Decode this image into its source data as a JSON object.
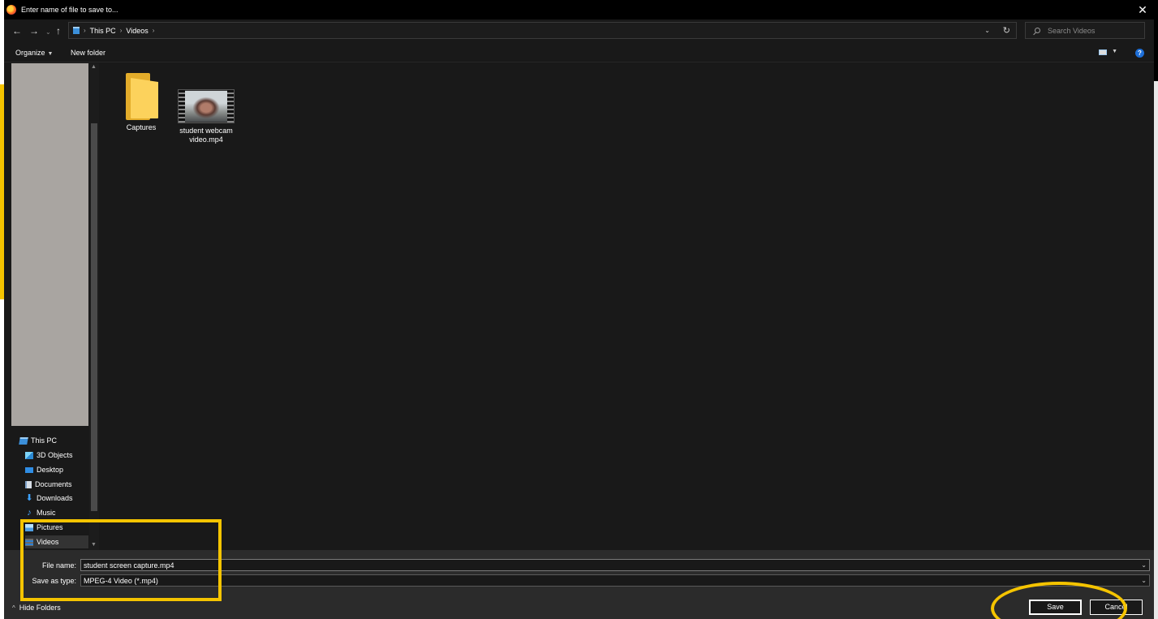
{
  "window": {
    "title": "Enter name of file to save to..."
  },
  "navigation": {
    "breadcrumb": [
      "This PC",
      "Videos"
    ],
    "search_placeholder": "Search Videos"
  },
  "toolbar": {
    "organize_label": "Organize",
    "new_folder_label": "New folder",
    "help_glyph": "?"
  },
  "sidebar": {
    "items": [
      {
        "label": "This PC",
        "icon": "this-pc-icon"
      },
      {
        "label": "3D Objects",
        "icon": "3d-objects-icon"
      },
      {
        "label": "Desktop",
        "icon": "desktop-icon"
      },
      {
        "label": "Documents",
        "icon": "documents-icon"
      },
      {
        "label": "Downloads",
        "icon": "downloads-icon"
      },
      {
        "label": "Music",
        "icon": "music-icon"
      },
      {
        "label": "Pictures",
        "icon": "pictures-icon"
      },
      {
        "label": "Videos",
        "icon": "videos-icon",
        "selected": true
      }
    ]
  },
  "files": [
    {
      "name": "Captures",
      "type": "folder"
    },
    {
      "name_line1": "student webcam",
      "name_line2": "video.mp4",
      "type": "video"
    }
  ],
  "form": {
    "file_name_label": "File name:",
    "file_name_value": "student screen capture.mp4",
    "save_as_type_label": "Save as type:",
    "save_as_type_value": "MPEG-4 Video (*.mp4)"
  },
  "footer": {
    "hide_folders_label": "Hide Folders",
    "save_label": "Save",
    "cancel_label": "Cancel"
  },
  "colors": {
    "annotation": "#f5c400",
    "dialog_bg": "#191919",
    "footer_bg": "#2b2b2b",
    "accent_blue": "#1e6fd8"
  }
}
